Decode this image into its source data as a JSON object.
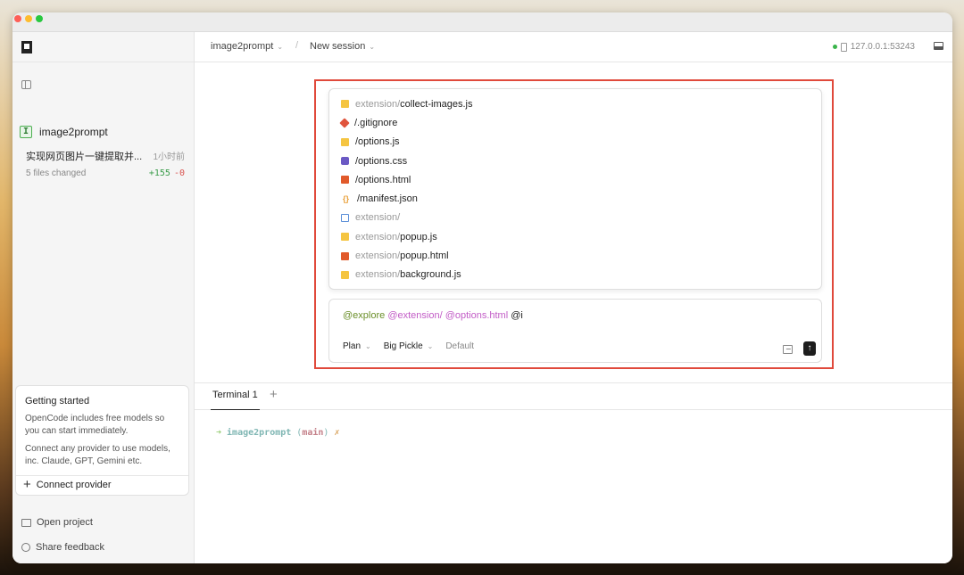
{
  "sidebar": {
    "project_badge": "I",
    "project_name": "image2prompt",
    "session": {
      "title": "实现网页图片一键提取并...",
      "time": "1小时前",
      "files_changed": "5 files changed",
      "additions": "+155",
      "deletions": "-0"
    },
    "getting_started": {
      "title": "Getting started",
      "p1": "OpenCode includes free models so you can start immediately.",
      "p2": "Connect any provider to use models, inc. Claude, GPT, Gemini etc.",
      "connect_label": "Connect provider"
    },
    "open_project_label": "Open project",
    "share_feedback_label": "Share feedback"
  },
  "topbar": {
    "project_crumb": "image2prompt",
    "separator": "/",
    "session_crumb": "New session",
    "server": "127.0.0.1:53243"
  },
  "suggestions": [
    {
      "dir": "extension/",
      "name": "collect-images.js",
      "icon": "js-icon"
    },
    {
      "dir": "",
      "name": "/.gitignore",
      "icon": "git-icon"
    },
    {
      "dir": "",
      "name": "/options.js",
      "icon": "js-icon"
    },
    {
      "dir": "",
      "name": "/options.css",
      "icon": "css-icon"
    },
    {
      "dir": "",
      "name": "/options.html",
      "icon": "html-icon"
    },
    {
      "dir": "",
      "name": "/manifest.json",
      "icon": "json-icon"
    },
    {
      "dir": "extension/",
      "name": "",
      "icon": "folder-icon"
    },
    {
      "dir": "extension/",
      "name": "popup.js",
      "icon": "js-icon"
    },
    {
      "dir": "extension/",
      "name": "popup.html",
      "icon": "html-icon"
    },
    {
      "dir": "extension/",
      "name": "background.js",
      "icon": "js-icon"
    }
  ],
  "prompt": {
    "agent_token": "@explore",
    "file_token_1": "@extension/",
    "file_token_2": "@options.html",
    "typing": "@i",
    "mode_label": "Plan",
    "model_label": "Big Pickle",
    "variant_label": "Default"
  },
  "terminal": {
    "tab_label": "Terminal 1",
    "arrow": "➜",
    "dir": "image2prompt",
    "branch_open": "(",
    "branch": "main",
    "branch_close": ")",
    "dirty": "✗"
  },
  "colors": {
    "highlight": "#e0493b",
    "agent_token": "#6a8e28",
    "file_token": "#c25cc6",
    "additions": "#3a9c4a",
    "deletions": "#d9534f"
  }
}
